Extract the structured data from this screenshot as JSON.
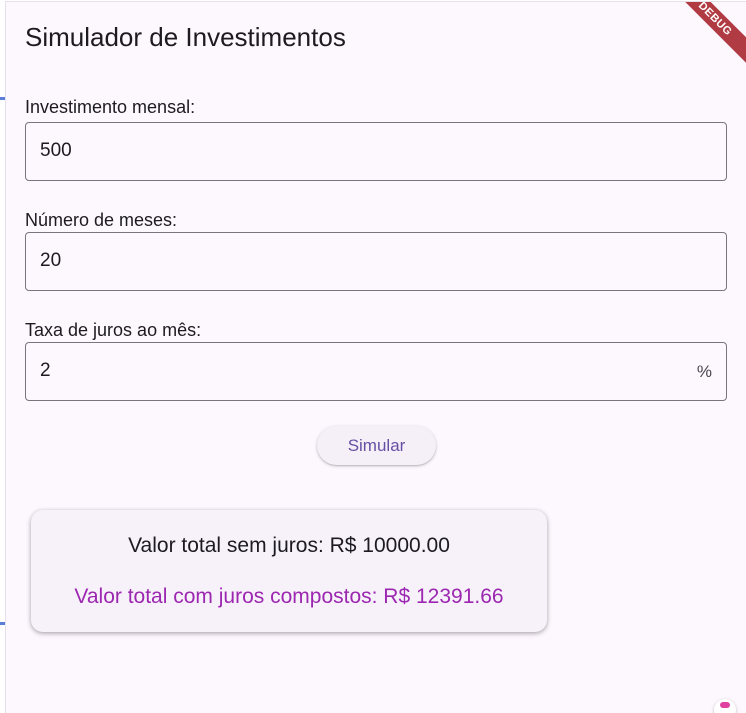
{
  "app": {
    "title": "Simulador de Investimentos",
    "debug_label": "DEBUG"
  },
  "form": {
    "monthly_investment": {
      "label": "Investimento mensal:",
      "value": "500"
    },
    "months": {
      "label": "Número de meses:",
      "value": "20"
    },
    "interest_rate": {
      "label": "Taxa de juros ao mês:",
      "value": "2",
      "suffix": "%"
    },
    "simulate_label": "Simular"
  },
  "results": {
    "simple_total": "Valor total sem juros: R$ 10000.00",
    "compound_total": "Valor total com juros compostos: R$ 12391.66"
  },
  "colors": {
    "background": "#fdf7fe",
    "accent": "#6750a4",
    "compound_text": "#9c27b0",
    "debug_banner": "#b13b43"
  }
}
